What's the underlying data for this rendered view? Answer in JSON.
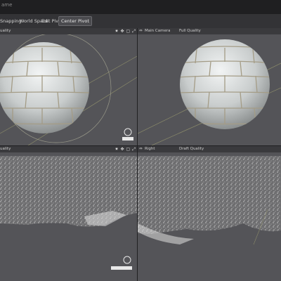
{
  "window": {
    "title": "ame"
  },
  "toolbar": {
    "items": [
      "Snapping",
      "World Space",
      "Edit Pivot"
    ],
    "center_pivot": "Center Pivot"
  },
  "viewports": {
    "top_left": {
      "quality": "uality"
    },
    "top_right": {
      "camera": "Main Camera",
      "quality": "Full Quality"
    },
    "bottom_left": {
      "quality": "uality"
    },
    "bottom_right": {
      "view": "Right",
      "quality": "Draft Quality"
    }
  },
  "icons": [
    "gear-icon",
    "move-icon",
    "frame-icon",
    "maximize-icon",
    "viewport-menu-icon",
    "axis-gizmo-icon"
  ],
  "colors": {
    "viewport_bg": "#545458",
    "header_bg": "#3a3a3d",
    "toolbar_bg": "#333336"
  }
}
